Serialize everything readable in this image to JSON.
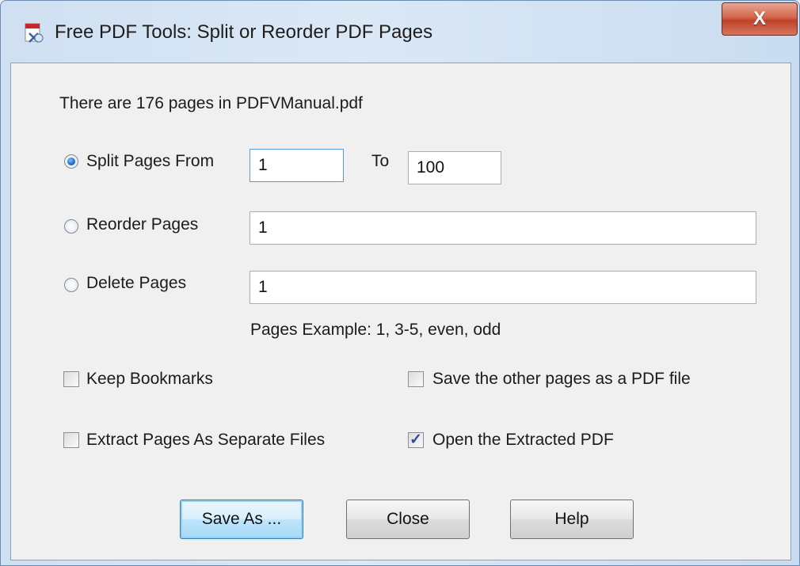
{
  "window": {
    "title": "Free PDF Tools: Split or Reorder PDF Pages",
    "close_label": "X",
    "app_icon": "pdf-tools-icon"
  },
  "info": {
    "page_count_text": "There are 176 pages in PDFVManual.pdf"
  },
  "split": {
    "label": "Split Pages From",
    "selected": true,
    "from_value": "1",
    "to_label": "To",
    "to_value": "100"
  },
  "reorder": {
    "label": "Reorder Pages",
    "selected": false,
    "value": "1"
  },
  "delete": {
    "label": "Delete Pages",
    "selected": false,
    "value": "1"
  },
  "pages_example": "Pages Example: 1, 3-5, even, odd",
  "options": {
    "keep_bookmarks": {
      "label": "Keep Bookmarks",
      "checked": false
    },
    "save_other_pages": {
      "label": "Save the other pages as a PDF file",
      "checked": false
    },
    "extract_separate": {
      "label": "Extract Pages As Separate Files",
      "checked": false
    },
    "open_extracted": {
      "label": "Open the Extracted PDF",
      "checked": true,
      "checkmark": "✓"
    }
  },
  "buttons": {
    "save_as": "Save As ...",
    "close": "Close",
    "help": "Help"
  },
  "colors": {
    "titlebar": "#d3e3f4",
    "close_button": "#c9472f",
    "dialog_bg": "#f0f0f0",
    "radio_selected": "#1b6bc4"
  }
}
